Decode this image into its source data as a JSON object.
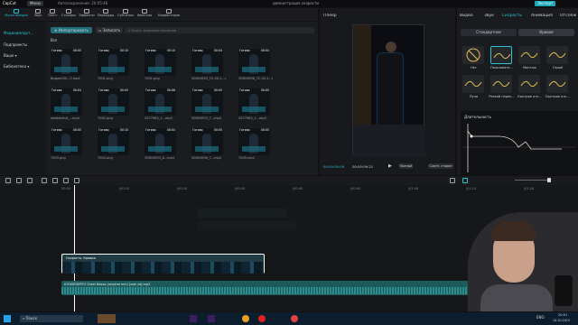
{
  "titlebar": {
    "app": "CapCut",
    "menu": "Меню",
    "autosave": "Автосохранение: 20:05:46",
    "project": "демонстрация скорости",
    "pro": "Экспорт"
  },
  "tabs": [
    "Мультимедиа",
    "Звук",
    "Текст",
    "Стикеры",
    "Эффекты",
    "Переходы",
    "Субтитры",
    "Фильтры",
    "Корректиров"
  ],
  "sidebar": {
    "items": [
      "Медиаимпорт...",
      "Подпроекты",
      "Ваше",
      "Библиотека"
    ]
  },
  "media": {
    "import_label": "Импортировать",
    "record_label": "Записать",
    "search_placeholder": "Поиск медиаматериалов",
    "all_label": "Все",
    "badge": "Готово",
    "items": [
      {
        "dur": "00:05",
        "name": "Видео000...0.mp4"
      },
      {
        "dur": "00:10",
        "name": "7001.png"
      },
      {
        "dur": "00:10",
        "name": "7001.png"
      },
      {
        "dur": "00:04",
        "name": "30603093_7C-00-1...mp4"
      },
      {
        "dur": "00:04",
        "name": "30603096_7C-00-1...mp4"
      },
      {
        "dur": "00:04",
        "name": "weldeblind_...mp4"
      },
      {
        "dur": "00:05",
        "name": "7002.png"
      },
      {
        "dur": "00:06",
        "name": "3077983_1...mp4"
      },
      {
        "dur": "00:05",
        "name": "30603093_7...mp4"
      },
      {
        "dur": "00:05",
        "name": "3077983_1...mp4"
      },
      {
        "dur": "00:05",
        "name": "7003.png"
      },
      {
        "dur": "00:10",
        "name": "7004.png"
      },
      {
        "dur": "00:04",
        "name": "30603093_8...mp4"
      },
      {
        "dur": "00:05",
        "name": "30603096_7...mp4"
      },
      {
        "dur": "00:05",
        "name": "7005.mp4"
      }
    ]
  },
  "player": {
    "title": "Плеер",
    "time_current": "00:00:00:00",
    "time_total": "00:00:09:21",
    "full_label": "Полный",
    "ratio_label": "Соотн. сторон"
  },
  "right": {
    "tabs": [
      "Видео",
      "Звук",
      "Скорость",
      "Анимация",
      "Отслеж"
    ],
    "subtabs": [
      "Стандартное",
      "Кривая"
    ],
    "presets": [
      "Нет",
      "Пользовате...",
      "Монтаж",
      "Герой",
      "Пули",
      "Резкий перех...",
      "Быстрое отк...",
      "Быстрое отк..."
    ],
    "duration_label": "Длительность"
  },
  "timeline": {
    "ruler": [
      "00:00",
      "|00:10",
      "|00:20",
      "|00:30",
      "|00:40",
      "|00:50",
      "|01:00",
      "|01:10",
      "|01:20"
    ],
    "clip_label": "Скорость: Кривая",
    "audio_label": "ICESSEDERTO Zvert Bassa (original mix) [ssm pt].mp3"
  },
  "taskbar": {
    "search_placeholder": "Поиск",
    "time": "20:01",
    "date": "10.10.2023",
    "lang": "ENG"
  }
}
